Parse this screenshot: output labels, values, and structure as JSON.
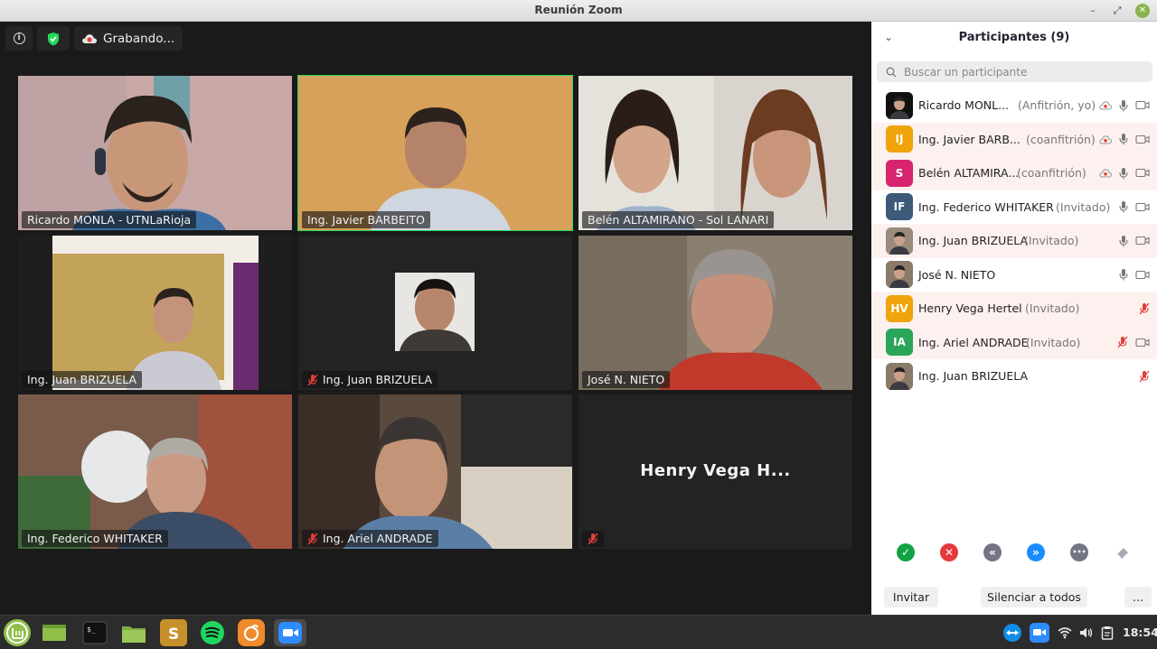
{
  "window": {
    "title": "Reunión Zoom",
    "min": "–",
    "max": "⤢",
    "close": "✕"
  },
  "topbar": {
    "recording": "Grabando..."
  },
  "tiles": [
    {
      "name": "Ricardo MONLA - UTNLaRioja",
      "muted": false
    },
    {
      "name": "Ing. Javier BARBEITO",
      "muted": false,
      "active": true
    },
    {
      "name": "Belén ALTAMIRANO - Sol LANARI",
      "muted": false
    },
    {
      "name": "Ing. Juan BRIZUELA",
      "muted": false
    },
    {
      "name": "Ing. Juan BRIZUELA",
      "muted": true
    },
    {
      "name": "José N. NIETO",
      "muted": false
    },
    {
      "name": "Ing. Federico WHITAKER",
      "muted": false
    },
    {
      "name": "Ing. Ariel ANDRADE",
      "muted": true
    },
    {
      "name": "",
      "big_name": "Henry Vega H...",
      "muted": true
    }
  ],
  "panel": {
    "title": "Participantes (9)",
    "search_placeholder": "Buscar un participante",
    "participants": [
      {
        "name": "Ricardo MONL...",
        "role": "(Anfitrión, yo)",
        "initials": "",
        "color": "#111111",
        "rec": true,
        "mic": "on",
        "cam": true
      },
      {
        "name": "Ing. Javier BARB...",
        "role": "(coanfitrión)",
        "initials": "IJ",
        "color": "#f0a30a",
        "rec": true,
        "mic": "on",
        "cam": true
      },
      {
        "name": "Belén ALTAMIRA...",
        "role": "(coanfitrión)",
        "initials": "S",
        "color": "#d6246e",
        "rec": true,
        "mic": "on",
        "cam": true
      },
      {
        "name": "Ing. Federico WHITAKER",
        "role": "(Invitado)",
        "initials": "IF",
        "color": "#3d5a7a",
        "rec": false,
        "mic": "on",
        "cam": true
      },
      {
        "name": "Ing. Juan BRIZUELA",
        "role": "(Invitado)",
        "initials": "",
        "color": "#9a8b7a",
        "rec": false,
        "mic": "on",
        "cam": true
      },
      {
        "name": "José N. NIETO",
        "role": "",
        "initials": "",
        "color": "#8a7a6a",
        "rec": false,
        "mic": "on",
        "cam": true
      },
      {
        "name": "Henry Vega Hertel",
        "role": "(Invitado)",
        "initials": "HV",
        "color": "#f0a30a",
        "rec": false,
        "mic": "off",
        "cam": false
      },
      {
        "name": "Ing. Ariel ANDRADE",
        "role": "(Invitado)",
        "initials": "IA",
        "color": "#2aa55a",
        "rec": false,
        "mic": "off",
        "cam": true
      },
      {
        "name": "Ing. Juan BRIZUELA",
        "role": "",
        "initials": "",
        "color": "#8a7a6a",
        "rec": false,
        "mic": "off",
        "cam": false
      }
    ],
    "reactions": [
      {
        "name": "yes",
        "glyph": "✓",
        "color": "#13a344"
      },
      {
        "name": "no",
        "glyph": "✕",
        "color": "#e5383b"
      },
      {
        "name": "slower",
        "glyph": "«",
        "color": "#747487"
      },
      {
        "name": "faster",
        "glyph": "»",
        "color": "#1a8cff"
      },
      {
        "name": "more",
        "glyph": "•••",
        "color": "#747487"
      },
      {
        "name": "clear",
        "glyph": "",
        "color": "#a9a9b3"
      }
    ],
    "invite": "Invitar",
    "mute_all": "Silenciar a todos",
    "more": "..."
  },
  "taskbar": {
    "clock": "18:54"
  }
}
